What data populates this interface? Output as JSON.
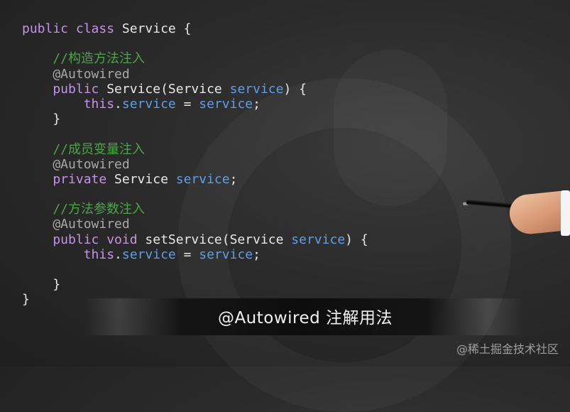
{
  "code": {
    "lines": [
      [
        {
          "t": "public class ",
          "c": "kw"
        },
        {
          "t": "Service {",
          "c": "cls"
        }
      ],
      [],
      [
        {
          "t": "    //构造方法注入",
          "c": "cmt"
        }
      ],
      [
        {
          "t": "    @Autowired",
          "c": "ann"
        }
      ],
      [
        {
          "t": "    public ",
          "c": "kw"
        },
        {
          "t": "Service(Service ",
          "c": "cls"
        },
        {
          "t": "service",
          "c": "var"
        },
        {
          "t": ") {",
          "c": "punc"
        }
      ],
      [
        {
          "t": "        this",
          "c": "kw"
        },
        {
          "t": ".",
          "c": "punc"
        },
        {
          "t": "service",
          "c": "var"
        },
        {
          "t": " = ",
          "c": "punc"
        },
        {
          "t": "service",
          "c": "var"
        },
        {
          "t": ";",
          "c": "punc"
        }
      ],
      [
        {
          "t": "    }",
          "c": "punc"
        }
      ],
      [],
      [
        {
          "t": "    //成员变量注入",
          "c": "cmt"
        }
      ],
      [
        {
          "t": "    @Autowired",
          "c": "ann"
        }
      ],
      [
        {
          "t": "    private ",
          "c": "kw"
        },
        {
          "t": "Service ",
          "c": "cls"
        },
        {
          "t": "service",
          "c": "var"
        },
        {
          "t": ";",
          "c": "punc"
        }
      ],
      [],
      [
        {
          "t": "    //方法参数注入",
          "c": "cmt"
        }
      ],
      [
        {
          "t": "    @Autowired",
          "c": "ann"
        }
      ],
      [
        {
          "t": "    public void ",
          "c": "kw"
        },
        {
          "t": "setService(Service ",
          "c": "cls"
        },
        {
          "t": "service",
          "c": "var"
        },
        {
          "t": ") {",
          "c": "punc"
        }
      ],
      [
        {
          "t": "        this",
          "c": "kw"
        },
        {
          "t": ".",
          "c": "punc"
        },
        {
          "t": "service",
          "c": "var"
        },
        {
          "t": " = ",
          "c": "punc"
        },
        {
          "t": "service",
          "c": "var"
        },
        {
          "t": ";",
          "c": "punc"
        }
      ],
      [],
      [
        {
          "t": "    }",
          "c": "punc"
        }
      ],
      [
        {
          "t": "}",
          "c": "punc"
        }
      ]
    ]
  },
  "caption": "@Autowired 注解用法",
  "watermark": "@稀土掘金技术社区",
  "colors": {
    "keyword": "#c792ea",
    "variable": "#5f9ee8",
    "annotation": "#a9a9a9",
    "comment": "#4ea44b",
    "text": "#e8e8e8"
  },
  "icons": [
    "pen-image",
    "hand-image"
  ]
}
